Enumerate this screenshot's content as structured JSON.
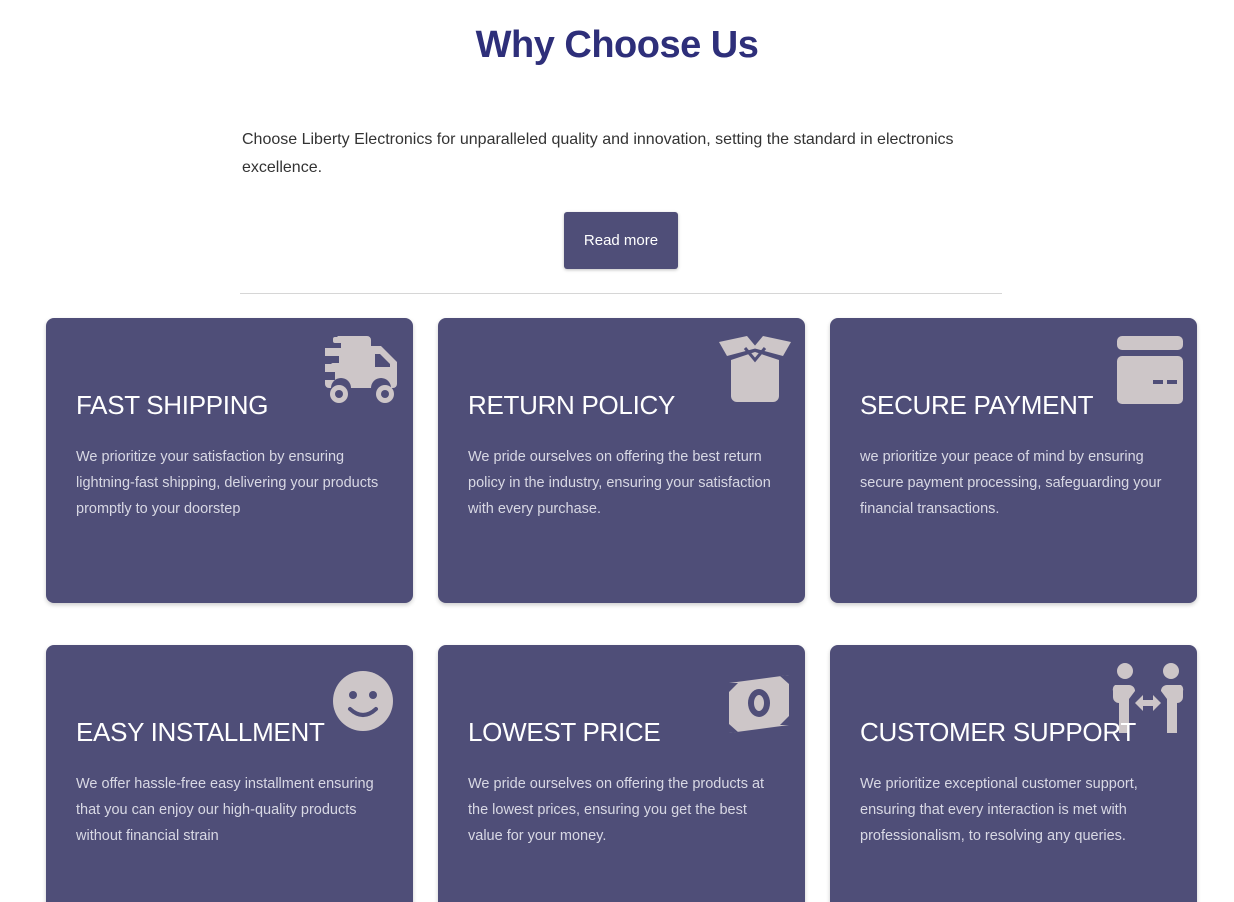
{
  "section": {
    "title": "Why Choose Us",
    "intro": "Choose Liberty Electronics for unparalleled quality and innovation, setting the standard in electronics excellence.",
    "read_more_label": "Read more"
  },
  "colors": {
    "card_bg": "#4f4e78",
    "title": "#2e2f7a",
    "icon": "#cdc6c8"
  },
  "cards": [
    {
      "title": "FAST SHIPPING",
      "text": "We prioritize your satisfaction by ensuring lightning-fast shipping, delivering your products promptly to your doorstep",
      "icon": "truck-fast-icon"
    },
    {
      "title": "RETURN POLICY",
      "text": "We pride ourselves on offering the best return policy in the industry, ensuring your satisfaction with every purchase.",
      "icon": "box-open-icon"
    },
    {
      "title": "SECURE PAYMENT",
      "text": "we prioritize your peace of mind by ensuring secure payment processing, safeguarding your financial transactions.",
      "icon": "credit-card-icon"
    },
    {
      "title": "EASY INSTALLMENT",
      "text": "We offer hassle-free easy installment ensuring that you can enjoy our high-quality products without financial strain",
      "icon": "smile-icon"
    },
    {
      "title": "LOWEST PRICE",
      "text": "We pride ourselves on offering the products at the lowest prices, ensuring you get the best value for your money.",
      "icon": "money-bill-icon"
    },
    {
      "title": "CUSTOMER SUPPORT",
      "text": "We prioritize exceptional customer support, ensuring that every interaction is met with professionalism, to resolving any queries.",
      "icon": "people-arrows-icon"
    }
  ]
}
